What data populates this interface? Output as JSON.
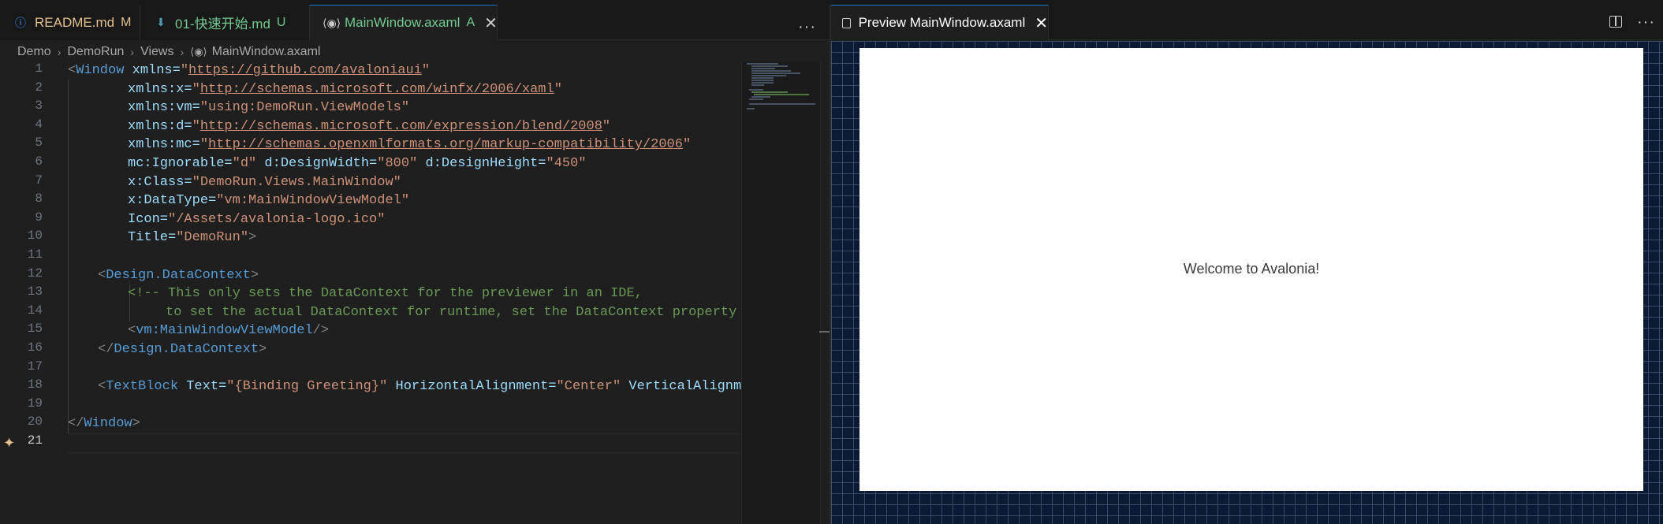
{
  "tabs": [
    {
      "label": "README.md",
      "status": "M",
      "icon": "info-icon"
    },
    {
      "label": "01-快速开始.md",
      "status": "U",
      "icon": "download-arrow-icon"
    },
    {
      "label": "MainWindow.axaml",
      "status": "A",
      "icon": "xml-brackets-icon"
    }
  ],
  "breadcrumb": [
    "Demo",
    "DemoRun",
    "Views",
    "MainWindow.axaml"
  ],
  "line_numbers": [
    "1",
    "2",
    "3",
    "4",
    "5",
    "6",
    "7",
    "8",
    "9",
    "10",
    "11",
    "12",
    "13",
    "14",
    "15",
    "16",
    "17",
    "18",
    "19",
    "20",
    "21"
  ],
  "code": {
    "l1": {
      "lt": "<",
      "tag": "Window",
      "attr": " xmlns=",
      "q1": "\"",
      "val": "https://github.com/avaloniaui",
      "q2": "\""
    },
    "l2": {
      "attr": "xmlns:x=",
      "q1": "\"",
      "val": "http://schemas.microsoft.com/winfx/2006/xaml",
      "q2": "\""
    },
    "l3": {
      "attr": "xmlns:vm=",
      "val": "\"using:DemoRun.ViewModels\""
    },
    "l4": {
      "attr": "xmlns:d=",
      "q1": "\"",
      "val": "http://schemas.microsoft.com/expression/blend/2008",
      "q2": "\""
    },
    "l5": {
      "attr": "xmlns:mc=",
      "q1": "\"",
      "val": "http://schemas.openxmlformats.org/markup-compatibility/2006",
      "q2": "\""
    },
    "l6": {
      "a1": "mc:Ignorable=",
      "v1": "\"d\"",
      "a2": " d:DesignWidth=",
      "v2": "\"800\"",
      "a3": " d:DesignHeight=",
      "v3": "\"450\""
    },
    "l7": {
      "attr": "x:Class=",
      "val": "\"DemoRun.Views.MainWindow\""
    },
    "l8": {
      "attr": "x:DataType=",
      "val": "\"vm:MainWindowViewModel\""
    },
    "l9": {
      "attr": "Icon=",
      "val": "\"/Assets/avalonia-logo.ico\""
    },
    "l10": {
      "attr": "Title=",
      "val": "\"DemoRun\"",
      "gt": ">"
    },
    "l12": {
      "lt": "<",
      "tag": "Design.DataContext",
      "gt": ">"
    },
    "l13": {
      "comment": "<!-- This only sets the DataContext for the previewer in an IDE,"
    },
    "l14": {
      "comment": "to set the actual DataContext for runtime, set the DataContext property in c"
    },
    "l15": {
      "lt": "<",
      "tag": "vm:MainWindowViewModel",
      "gt": "/>"
    },
    "l16": {
      "lt": "</",
      "tag": "Design.DataContext",
      "gt": ">"
    },
    "l18": {
      "lt": "<",
      "tag": "TextBlock",
      "a1": " Text=",
      "v1": "\"{Binding Greeting}\"",
      "a2": " HorizontalAlignment=",
      "v2": "\"Center\"",
      "a3": " VerticalAlignment=",
      "v3": "\""
    },
    "l20": {
      "lt": "</",
      "tag": "Window",
      "gt": ">"
    }
  },
  "preview": {
    "tab_label": "Preview MainWindow.axaml",
    "welcome_text": "Welcome to Avalonia!"
  },
  "toolbar": {
    "more": "···",
    "close": "✕"
  },
  "colors": {
    "tag": "#569cd6",
    "attr": "#9cdcfe",
    "string": "#ce9178",
    "comment": "#6a9955",
    "accent": "#0078d4"
  }
}
